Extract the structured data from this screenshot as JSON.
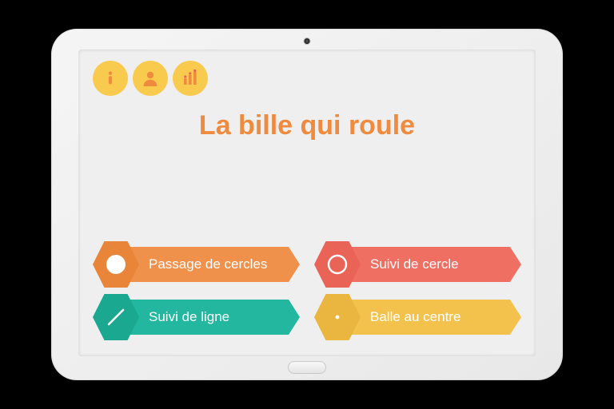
{
  "title": "La bille qui roule",
  "topIcons": {
    "info": "info-icon",
    "user": "user-icon",
    "stats": "stats-icon"
  },
  "options": [
    {
      "label": "Passage de cercles",
      "icon": "filled-circle-icon",
      "color": "c-orange"
    },
    {
      "label": "Suivi de cercle",
      "icon": "ring-icon",
      "color": "c-coral"
    },
    {
      "label": "Suivi de ligne",
      "icon": "line-icon",
      "color": "c-teal"
    },
    {
      "label": "Balle au centre",
      "icon": "dot-icon",
      "color": "c-yellow2"
    }
  ]
}
